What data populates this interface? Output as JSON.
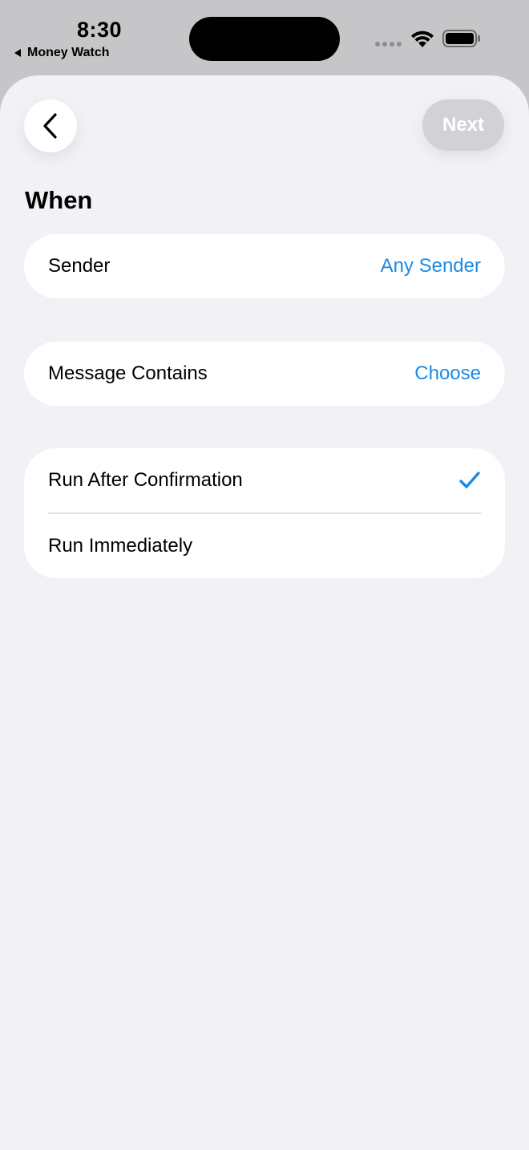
{
  "status_bar": {
    "time": "8:30",
    "back_app_label": "Money Watch"
  },
  "nav": {
    "next_label": "Next"
  },
  "section": {
    "title": "When"
  },
  "rows": {
    "sender": {
      "label": "Sender",
      "value": "Any Sender"
    },
    "message_contains": {
      "label": "Message Contains",
      "value": "Choose"
    }
  },
  "run_options": [
    {
      "label": "Run After Confirmation",
      "selected": true
    },
    {
      "label": "Run Immediately",
      "selected": false
    }
  ],
  "colors": {
    "accent": "#1b8ae6",
    "sheet_background": "#f1f1f6",
    "status_background": "#c6c6c9",
    "next_disabled": "#d2d2d6"
  }
}
